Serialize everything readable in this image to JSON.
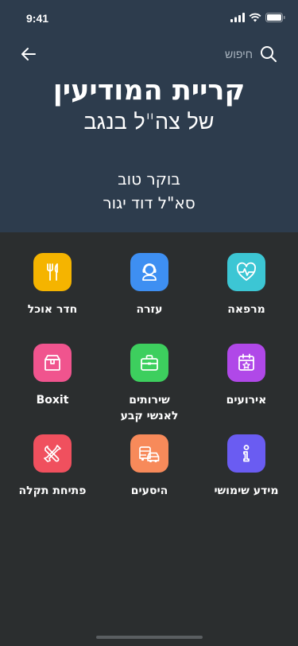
{
  "status_bar": {
    "time": "9:41"
  },
  "nav": {
    "search_label": "חיפוש"
  },
  "header": {
    "title": "קריית המודיעין",
    "subtitle": "של צה\"ל בנגב",
    "greeting": "בוקר טוב",
    "user_name": "סא\"ל דוד יגור"
  },
  "tiles": [
    {
      "label": "מרפאה",
      "icon": "heart-pulse-icon",
      "color": "#3cc6d4"
    },
    {
      "label": "עזרה",
      "icon": "support-agent-icon",
      "color": "#3e8ff2"
    },
    {
      "label": "חדר אוכל",
      "icon": "fork-knife-icon",
      "color": "#f5b400"
    },
    {
      "label": "אירועים",
      "icon": "calendar-star-icon",
      "color": "#b048e8"
    },
    {
      "label": "שירותים\nלאנשי קבע",
      "icon": "briefcase-icon",
      "color": "#3dcf5e"
    },
    {
      "label": "Boxit",
      "icon": "package-box-icon",
      "color": "#f0548e"
    },
    {
      "label": "מידע שימושי",
      "icon": "info-icon",
      "color": "#6a5cf2"
    },
    {
      "label": "היסעים",
      "icon": "bus-car-icon",
      "color": "#f78a5a"
    },
    {
      "label": "פתיחת תקלה",
      "icon": "tools-icon",
      "color": "#f0505e"
    }
  ]
}
